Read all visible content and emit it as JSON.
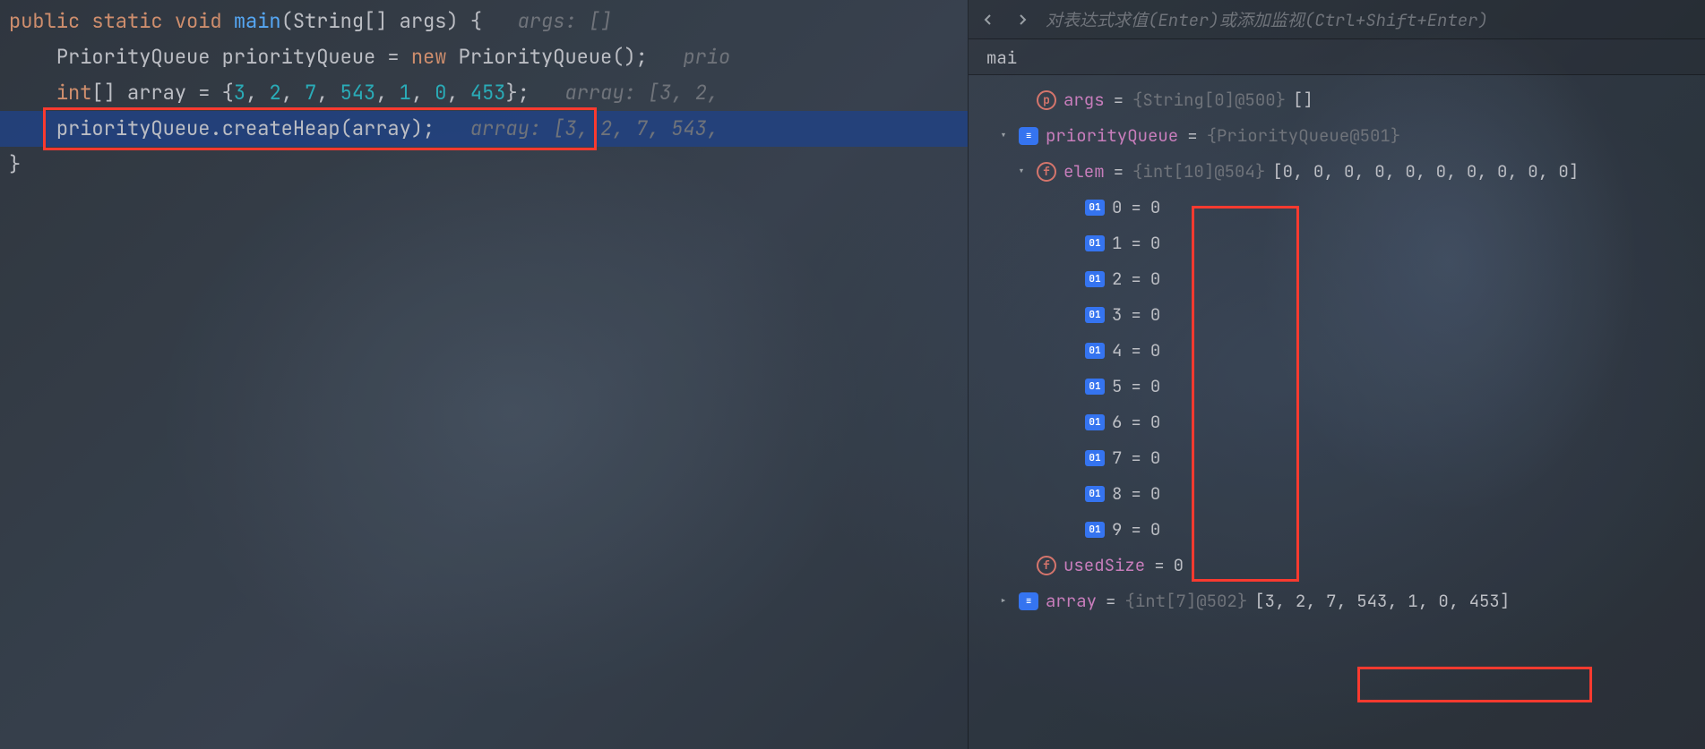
{
  "code": {
    "line1_public": "public",
    "line1_static": "static",
    "line1_void": "void",
    "line1_main": "main",
    "line1_params": "(String[] args) {",
    "line1_comment": "args: []",
    "line2_type1": "PriorityQueue priorityQueue = ",
    "line2_new": "new",
    "line2_type2": " PriorityQueue();",
    "line2_comment": "prio",
    "line3_int": "int",
    "line3_arr1": "[] array = {",
    "line3_n0": "3",
    "line3_n1": "2",
    "line3_n2": "7",
    "line3_n3": "543",
    "line3_n4": "1",
    "line3_n5": "0",
    "line3_n6": "453",
    "line3_close": "};",
    "line3_comment": "array: [3, 2,",
    "line4_code": "priorityQueue.createHeap(array);",
    "line4_comment": "array: [3, 2, 7, 543,",
    "line5": "}"
  },
  "debug": {
    "toolbar": {
      "eval_placeholder": "对表达式求值(Enter)或添加监视(Ctrl+Shift+Enter)"
    },
    "tabs": {
      "main": "mai"
    },
    "vars": {
      "args": {
        "name": "args",
        "type": "{String[0]@500}",
        "val": "[]"
      },
      "priorityQueue": {
        "name": "priorityQueue",
        "type": "{PriorityQueue@501}"
      },
      "elem": {
        "name": "elem",
        "type": "{int[10]@504}",
        "val": "[0, 0, 0, 0, 0, 0, 0, 0, 0, 0]"
      },
      "elem_items": [
        {
          "k": "0",
          "v": "0"
        },
        {
          "k": "1",
          "v": "0"
        },
        {
          "k": "2",
          "v": "0"
        },
        {
          "k": "3",
          "v": "0"
        },
        {
          "k": "4",
          "v": "0"
        },
        {
          "k": "5",
          "v": "0"
        },
        {
          "k": "6",
          "v": "0"
        },
        {
          "k": "7",
          "v": "0"
        },
        {
          "k": "8",
          "v": "0"
        },
        {
          "k": "9",
          "v": "0"
        }
      ],
      "usedSize": {
        "name": "usedSize",
        "val": "0"
      },
      "array": {
        "name": "array",
        "type": "{int[7]@502}",
        "val": "[3, 2, 7, 543, 1, 0, 453]"
      }
    }
  }
}
